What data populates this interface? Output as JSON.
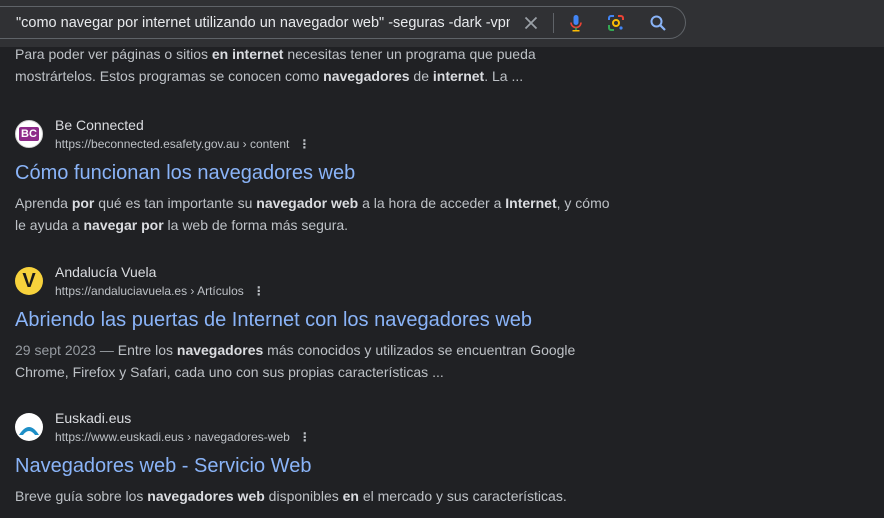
{
  "search": {
    "query": "\"como navegar por internet utilizando un navegador web\" -seguras -dark -vpn",
    "clear_icon": "close-icon",
    "voice_icon": "microphone-icon",
    "lens_icon": "camera-lens-icon",
    "search_icon": "search-icon"
  },
  "colors": {
    "background": "#202124",
    "link": "#8ab4f8",
    "text": "#bdc1c6",
    "bold_text": "#dadce0"
  },
  "top_snippet": [
    {
      "t": "Para poder ver páginas o sitios "
    },
    {
      "b": "en internet"
    },
    {
      "t": " necesitas tener un programa que pueda mostrártelos. Estos programas se conocen como "
    },
    {
      "b": "navegadores"
    },
    {
      "t": " de "
    },
    {
      "b": "internet"
    },
    {
      "t": ". La ..."
    }
  ],
  "results": [
    {
      "site_name": "Be Connected",
      "url": "https://beconnected.esafety.gov.au › content",
      "favicon_text": "BC",
      "title": "Cómo funcionan los navegadores web",
      "snippet": [
        {
          "t": "Aprenda "
        },
        {
          "b": "por"
        },
        {
          "t": " qué es tan importante su "
        },
        {
          "b": "navegador web"
        },
        {
          "t": " a la hora de acceder a "
        },
        {
          "b": "Internet"
        },
        {
          "t": ", y cómo le ayuda a "
        },
        {
          "b": "navegar por"
        },
        {
          "t": " la web de forma más segura."
        }
      ]
    },
    {
      "site_name": "Andalucía Vuela",
      "url": "https://andaluciavuela.es › Artículos",
      "favicon_text": "V",
      "title": "Abriendo las puertas de Internet con los navegadores web",
      "date": "29 sept 2023 — ",
      "snippet": [
        {
          "t": "Entre los "
        },
        {
          "b": "navegadores"
        },
        {
          "t": " más conocidos y utilizados se encuentran Google Chrome, Firefox y Safari, cada uno con sus propias características ..."
        }
      ]
    },
    {
      "site_name": "Euskadi.eus",
      "url": "https://www.euskadi.eus › navegadores-web",
      "favicon_text": "",
      "title": "Navegadores web - Servicio Web",
      "snippet": [
        {
          "t": "Breve guía sobre los "
        },
        {
          "b": "navegadores web"
        },
        {
          "t": " disponibles "
        },
        {
          "b": "en"
        },
        {
          "t": " el mercado y sus características."
        }
      ]
    }
  ],
  "more_glyph": "⋮"
}
